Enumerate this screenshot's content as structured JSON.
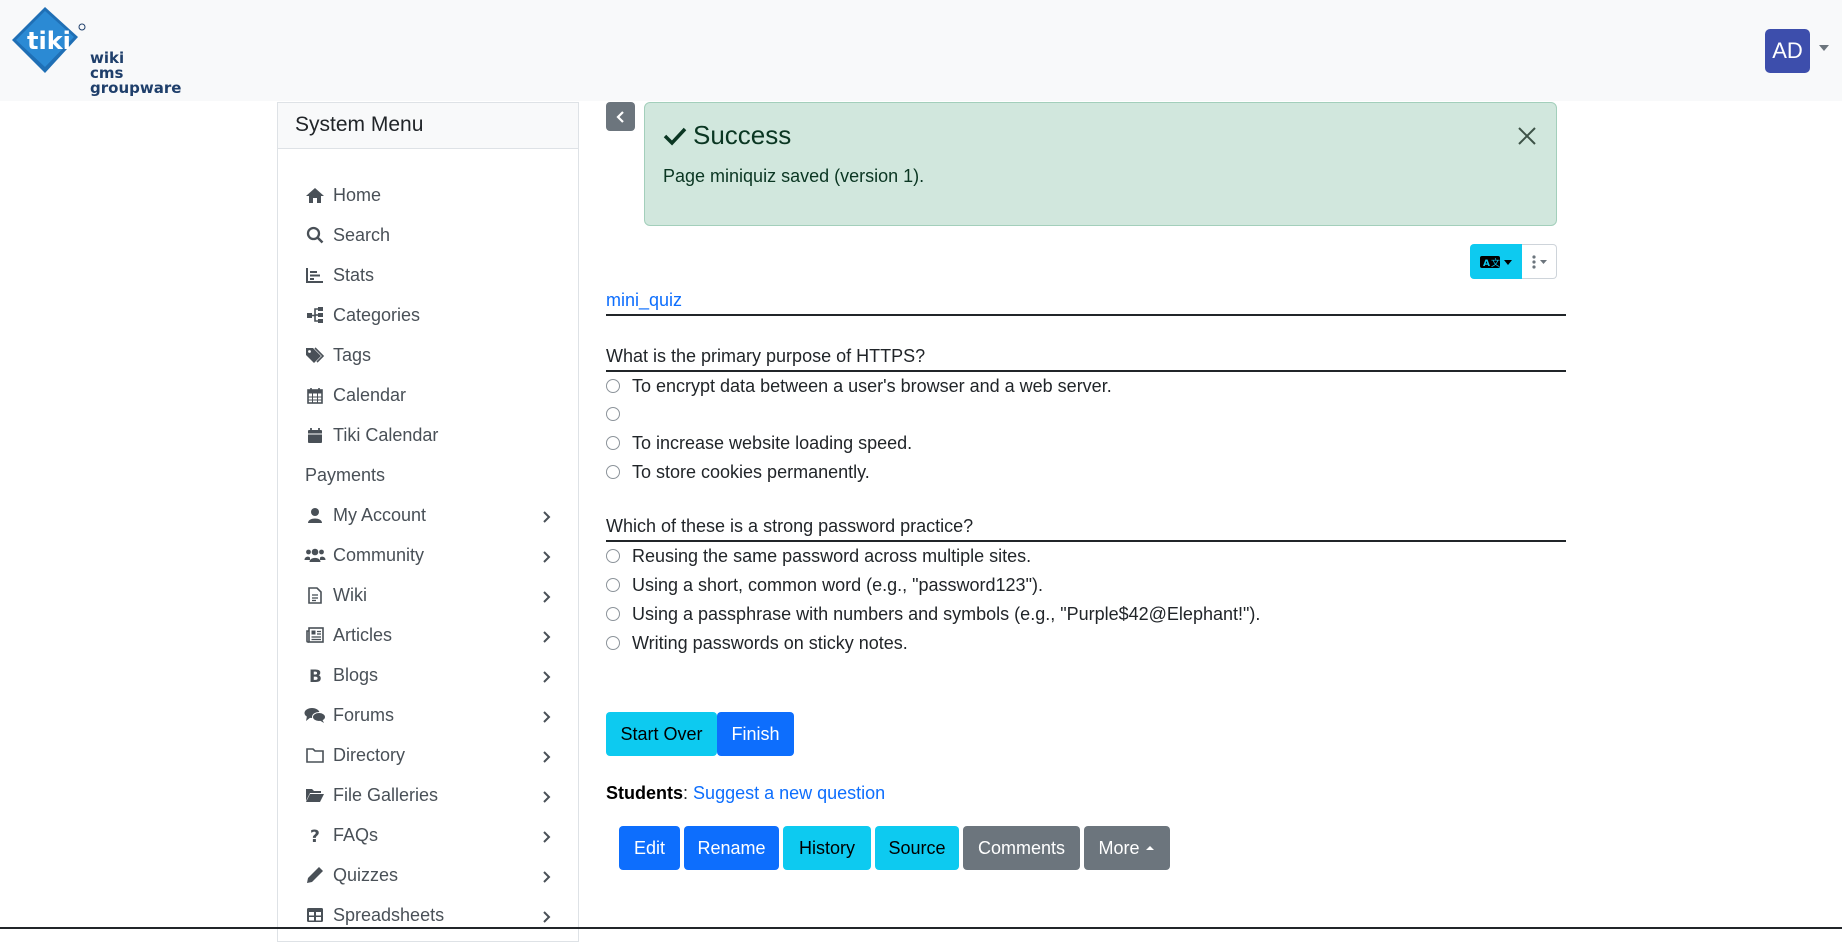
{
  "logo": {
    "line1": "wiki",
    "line2": "cms",
    "line3": "groupware"
  },
  "user": {
    "initials": "AD"
  },
  "sidebar": {
    "title": "System Menu",
    "items": [
      {
        "label": "Home",
        "icon": "home-icon",
        "arrow": false
      },
      {
        "label": "Search",
        "icon": "search-icon",
        "arrow": false
      },
      {
        "label": "Stats",
        "icon": "chart-icon",
        "arrow": false
      },
      {
        "label": "Categories",
        "icon": "sitemap-icon",
        "arrow": false
      },
      {
        "label": "Tags",
        "icon": "tags-icon",
        "arrow": false
      },
      {
        "label": "Calendar",
        "icon": "calendar-grid-icon",
        "arrow": false
      },
      {
        "label": "Tiki Calendar",
        "icon": "calendar-icon",
        "arrow": false
      },
      {
        "label": "Payments",
        "icon": "",
        "arrow": false
      },
      {
        "label": "My Account",
        "icon": "user-icon",
        "arrow": true
      },
      {
        "label": "Community",
        "icon": "users-icon",
        "arrow": true
      },
      {
        "label": "Wiki",
        "icon": "file-icon",
        "arrow": true
      },
      {
        "label": "Articles",
        "icon": "newspaper-icon",
        "arrow": true
      },
      {
        "label": "Blogs",
        "icon": "bold-b-icon",
        "arrow": true
      },
      {
        "label": "Forums",
        "icon": "comments-icon",
        "arrow": true
      },
      {
        "label": "Directory",
        "icon": "folder-icon",
        "arrow": true
      },
      {
        "label": "File Galleries",
        "icon": "folder-open-icon",
        "arrow": true
      },
      {
        "label": "FAQs",
        "icon": "question-icon",
        "arrow": true
      },
      {
        "label": "Quizzes",
        "icon": "pencil-icon",
        "arrow": true
      },
      {
        "label": "Spreadsheets",
        "icon": "table-icon",
        "arrow": true
      }
    ]
  },
  "alert": {
    "title": "Success",
    "message": "Page miniquiz saved (version 1)."
  },
  "page": {
    "quiz_link": "mini_quiz",
    "questions": [
      {
        "title": "What is the primary purpose of HTTPS?",
        "options": [
          "To encrypt data between a user's browser and a web server.",
          "",
          "To increase website loading speed.",
          "To store cookies permanently."
        ]
      },
      {
        "title": "Which of these is a strong password practice?",
        "options": [
          "Reusing the same password across multiple sites.",
          "Using a short, common word (e.g., \"password123\").",
          "Using a passphrase with numbers and symbols (e.g., \"Purple$42@Elephant!\").",
          "Writing passwords on sticky notes."
        ]
      }
    ],
    "start_over": "Start Over",
    "finish": "Finish",
    "students_label": "Students",
    "students_sep": ":",
    "suggest_link": "Suggest a new question"
  },
  "actions": {
    "edit": "Edit",
    "rename": "Rename",
    "history": "History",
    "source": "Source",
    "comments": "Comments",
    "more": "More"
  },
  "colors": {
    "primary": "#0d6efd",
    "info": "#0dcaf0",
    "secondary": "#6c757d",
    "success_bg": "#d1e7dd",
    "avatar": "#3d4eac"
  }
}
